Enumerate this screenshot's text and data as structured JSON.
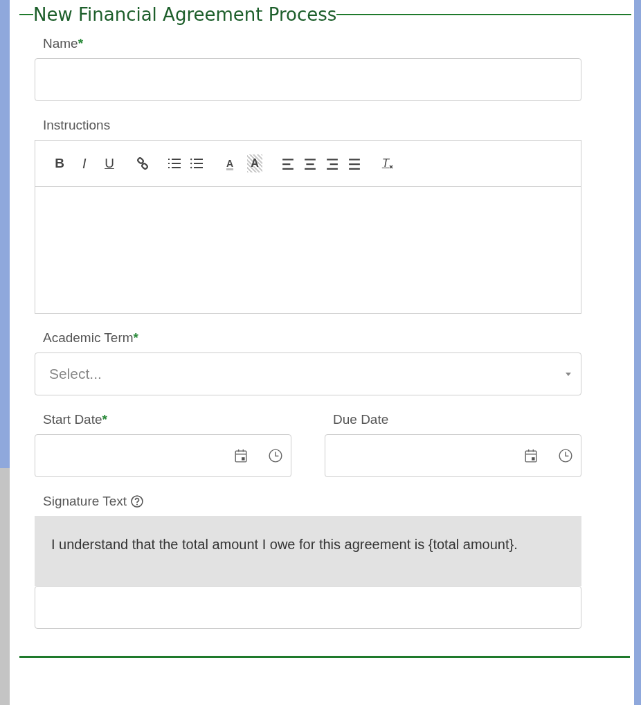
{
  "legend": {
    "title": "New Financial Agreement Process"
  },
  "name_field": {
    "label": "Name",
    "required_mark": "*"
  },
  "instructions": {
    "label": "Instructions",
    "toolbar_groups": [
      [
        {
          "kind": "bold",
          "glyph": "B"
        },
        {
          "kind": "italic",
          "glyph": "I"
        },
        {
          "kind": "underline",
          "glyph": "U"
        }
      ],
      [
        {
          "kind": "link"
        }
      ],
      [
        {
          "kind": "ordered-list"
        },
        {
          "kind": "bullet-list"
        }
      ],
      [
        {
          "kind": "text-color",
          "glyph": "A"
        },
        {
          "kind": "highlight",
          "glyph": "A"
        }
      ],
      [
        {
          "kind": "align-left"
        },
        {
          "kind": "align-center"
        },
        {
          "kind": "align-right"
        },
        {
          "kind": "justify"
        }
      ],
      [
        {
          "kind": "clear-format",
          "glyph": "T"
        }
      ]
    ]
  },
  "academic_term": {
    "label": "Academic Term",
    "required_mark": "*",
    "placeholder": "Select..."
  },
  "dates": [
    {
      "label": "Start Date",
      "required_mark": "*"
    },
    {
      "label": "Due Date"
    }
  ],
  "signature": {
    "label": "Signature Text",
    "text": "I understand that the total amount I owe for this agreement is {total amount}."
  }
}
